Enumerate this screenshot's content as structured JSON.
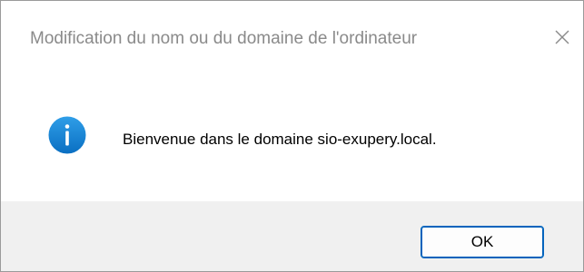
{
  "dialog": {
    "title": "Modification du nom ou du domaine de l'ordinateur",
    "close_icon": "close-icon",
    "message_icon": "info-icon",
    "message": "Bienvenue dans le domaine sio-exupery.local.",
    "ok_label": "OK"
  },
  "colors": {
    "accent": "#0067c0",
    "footer_bg": "#f0f0f0",
    "title_text": "#8a8a8a"
  }
}
